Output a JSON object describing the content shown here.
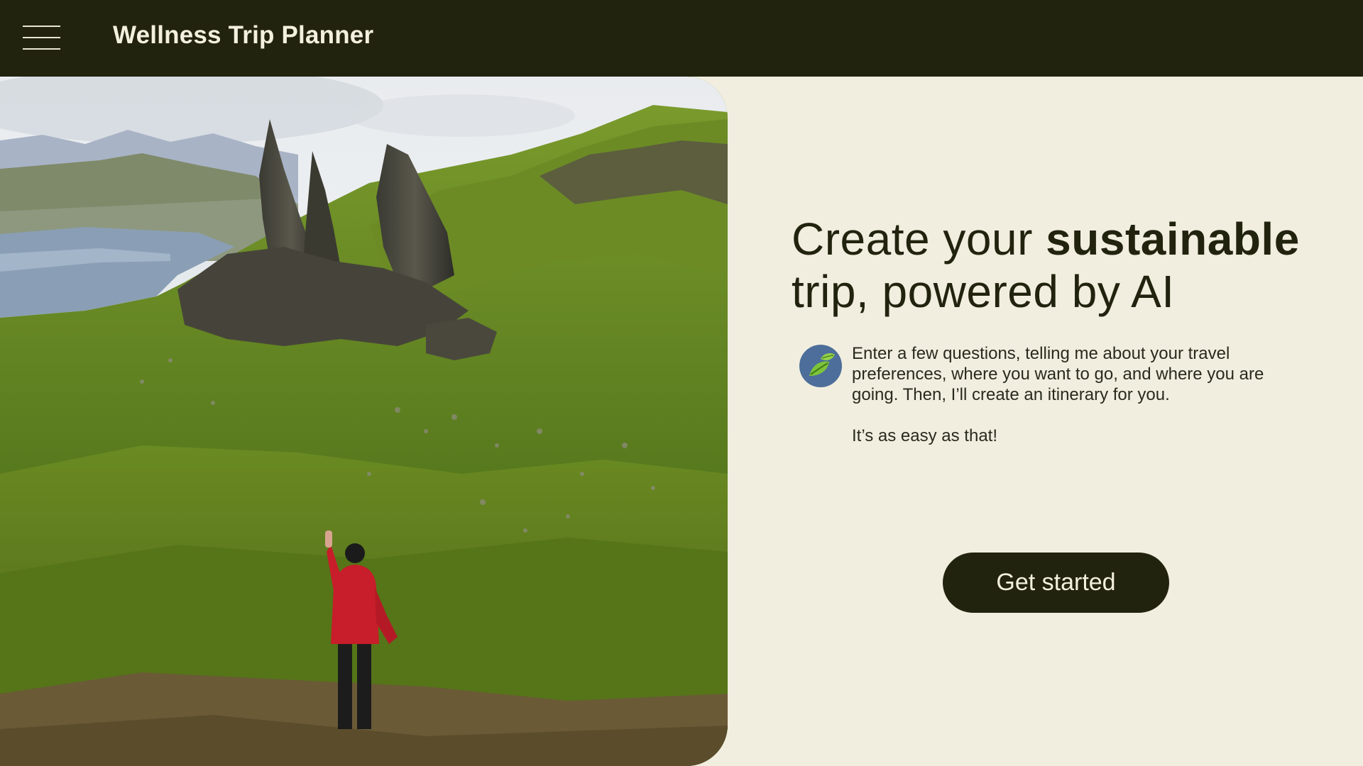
{
  "header": {
    "menu_icon": "hamburger-menu-icon",
    "title": "Wellness Trip Planner"
  },
  "hero_image": {
    "subject": "person in red jacket waving on green mountain ridge"
  },
  "main": {
    "headline_part1": "Create your ",
    "headline_bold": "sustainable",
    "headline_part2": "trip, powered by AI",
    "assistant_avatar_icon": "leaf-icon",
    "intro_text": "Enter a few questions, telling me about your travel preferences, where you want to go, and where you are going. Then, I’ll create an itinerary for you.",
    "tagline": "It’s as easy as that!",
    "cta_label": "Get started"
  },
  "colors": {
    "header_bg": "#22230f",
    "page_bg": "#f1eedf",
    "text_dark": "#22230f",
    "cta_bg": "#22230f",
    "cta_text": "#f3f0e0",
    "avatar_bg": "#4d6e9a"
  }
}
